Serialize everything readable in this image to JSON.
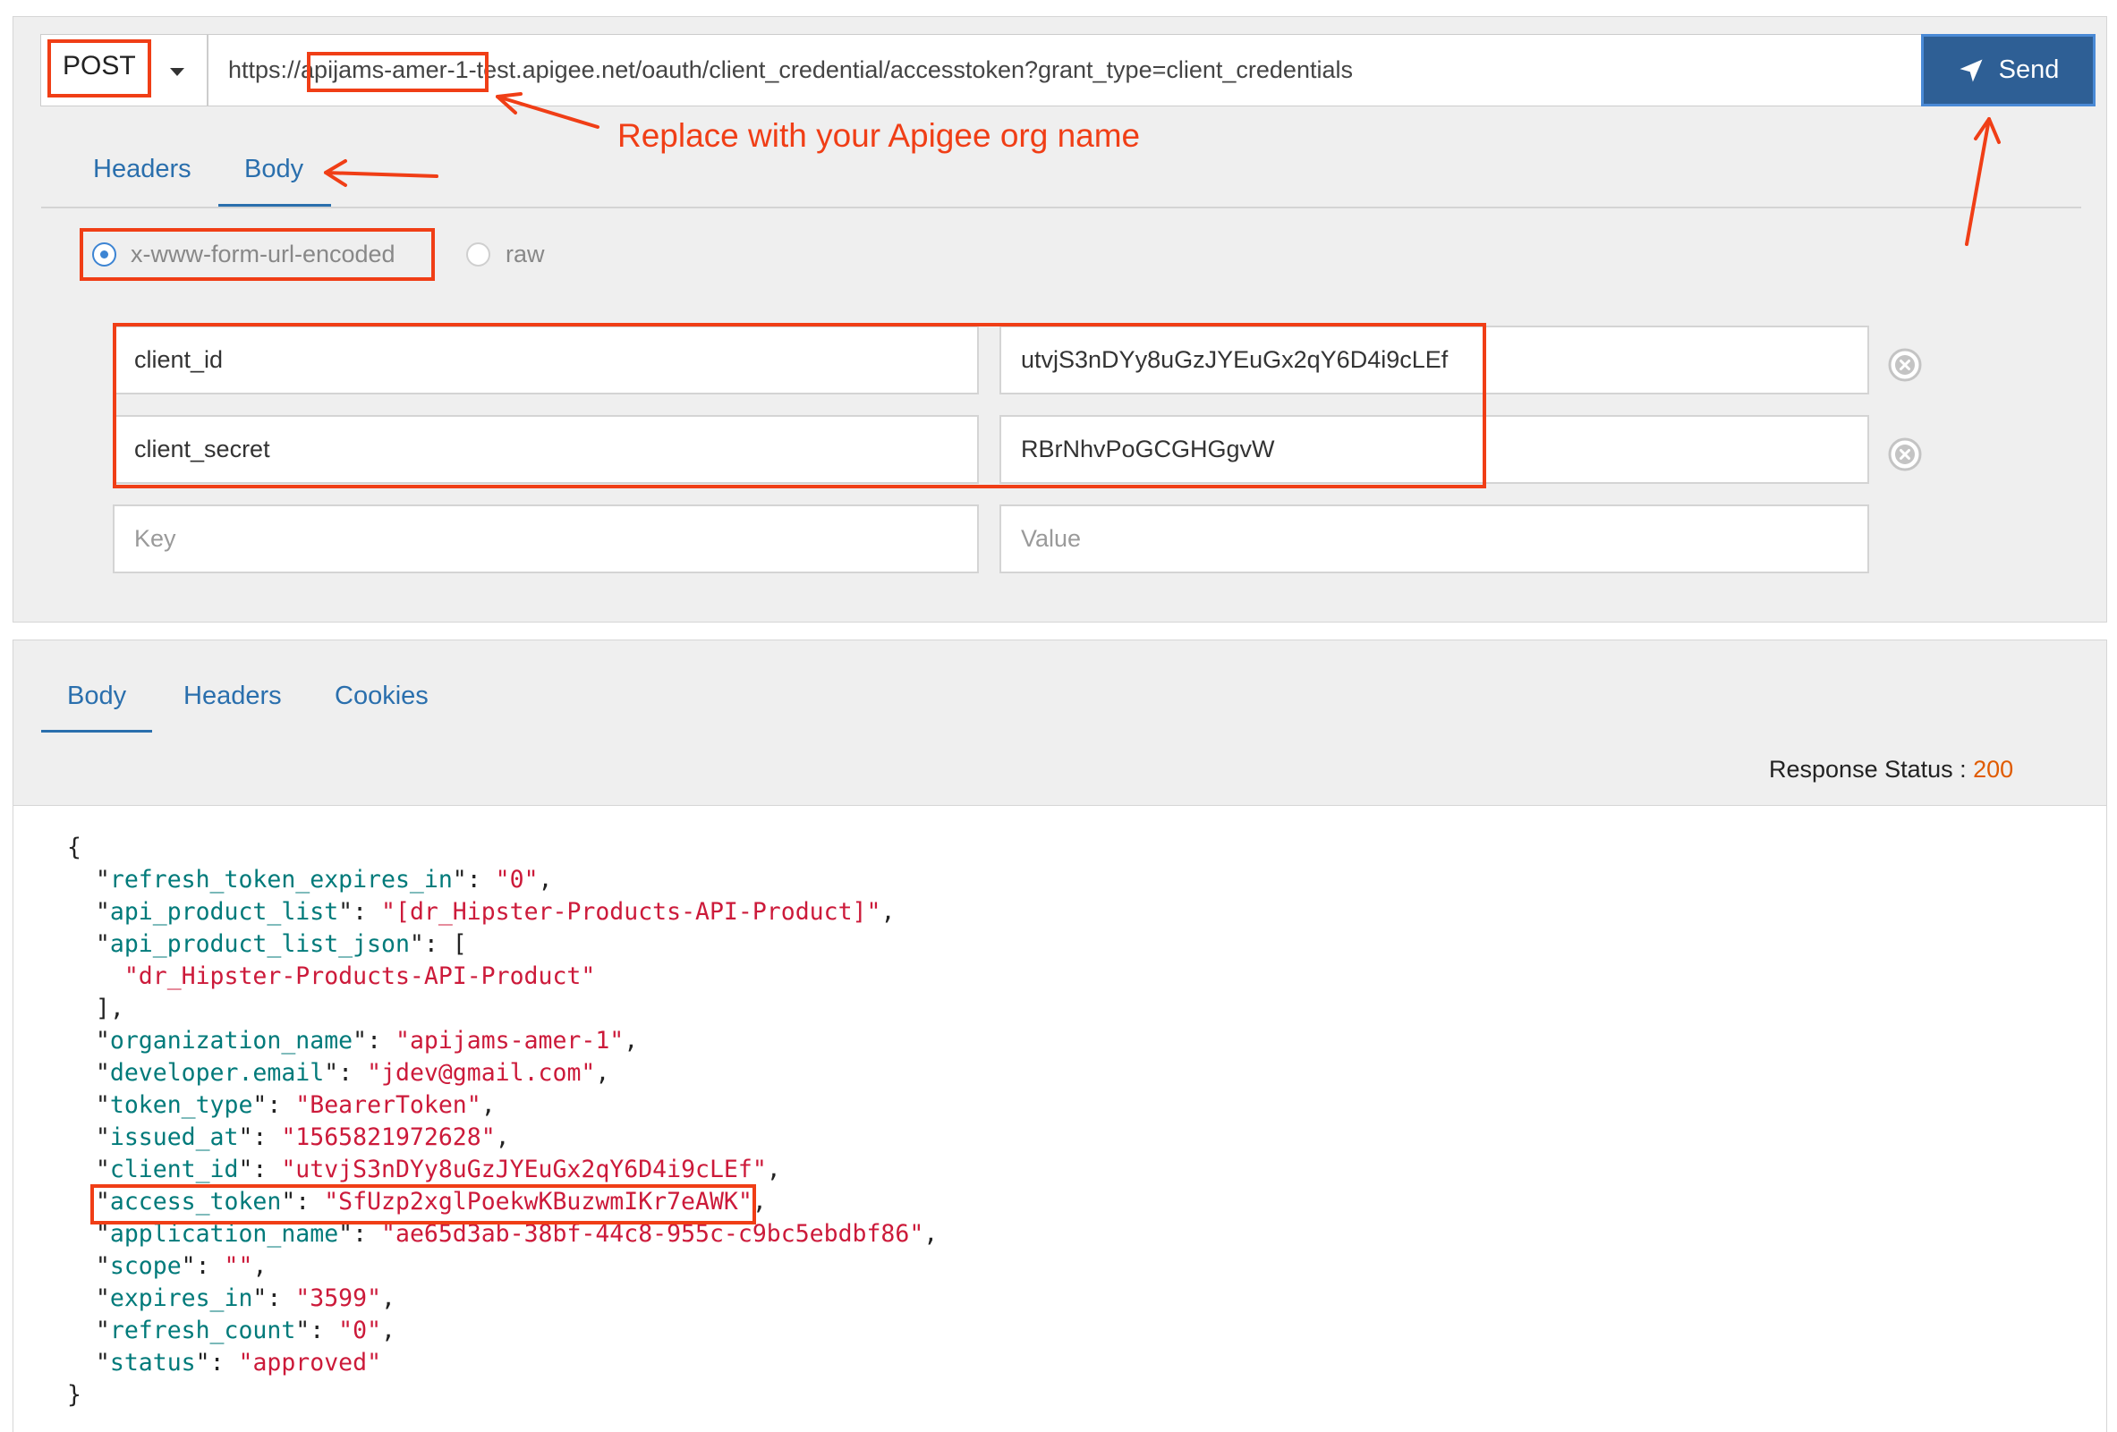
{
  "request": {
    "method": "POST",
    "url": "https://apijams-amer-1-test.apigee.net/oauth/client_credential/accesstoken?grant_type=client_credentials",
    "send_label": "Send",
    "tabs": [
      {
        "label": "Headers"
      },
      {
        "label": "Body"
      }
    ],
    "active_tab": "Body",
    "body_types": [
      {
        "label": "x-www-form-url-encoded",
        "selected": true
      },
      {
        "label": "raw",
        "selected": false
      }
    ],
    "params": [
      {
        "key": "client_id",
        "value": "utvjS3nDYy8uGzJYEuGx2qY6D4i9cLEf"
      },
      {
        "key": "client_secret",
        "value": "RBrNhvPoGCGHGgvW"
      }
    ],
    "new_param": {
      "key_placeholder": "Key",
      "value_placeholder": "Value"
    }
  },
  "annotation": {
    "text": "Replace with your Apigee org name",
    "color": "#f03e16"
  },
  "response": {
    "tabs": [
      {
        "label": "Body"
      },
      {
        "label": "Headers"
      },
      {
        "label": "Cookies"
      }
    ],
    "active_tab": "Body",
    "status_label": "Response Status : ",
    "status_code": "200",
    "body_lines": [
      "{",
      "  \"refresh_token_expires_in\": \"0\",",
      "  \"api_product_list\": \"[dr_Hipster-Products-API-Product]\",",
      "  \"api_product_list_json\": [",
      "    \"dr_Hipster-Products-API-Product\"",
      "  ],",
      "  \"organization_name\": \"apijams-amer-1\",",
      "  \"developer.email\": \"jdev@gmail.com\",",
      "  \"token_type\": \"BearerToken\",",
      "  \"issued_at\": \"1565821972628\",",
      "  \"client_id\": \"utvjS3nDYy8uGzJYEuGx2qY6D4i9cLEf\",",
      "  \"access_token\": \"SfUzp2xglPoekwKBuzwmIKr7eAWK\",",
      "  \"application_name\": \"ae65d3ab-38bf-44c8-955c-c9bc5ebdbf86\",",
      "  \"scope\": \"\",",
      "  \"expires_in\": \"3599\",",
      "  \"refresh_count\": \"0\",",
      "  \"status\": \"approved\"",
      "}"
    ]
  },
  "colors": {
    "accent_blue": "#2a6fad",
    "send_button": "#2e5f95",
    "status_code": "#e05b00",
    "json_key": "#007a7a",
    "json_string": "#cc1a3a"
  },
  "icons": [
    "chevron-down-icon",
    "send-icon",
    "remove-icon"
  ]
}
